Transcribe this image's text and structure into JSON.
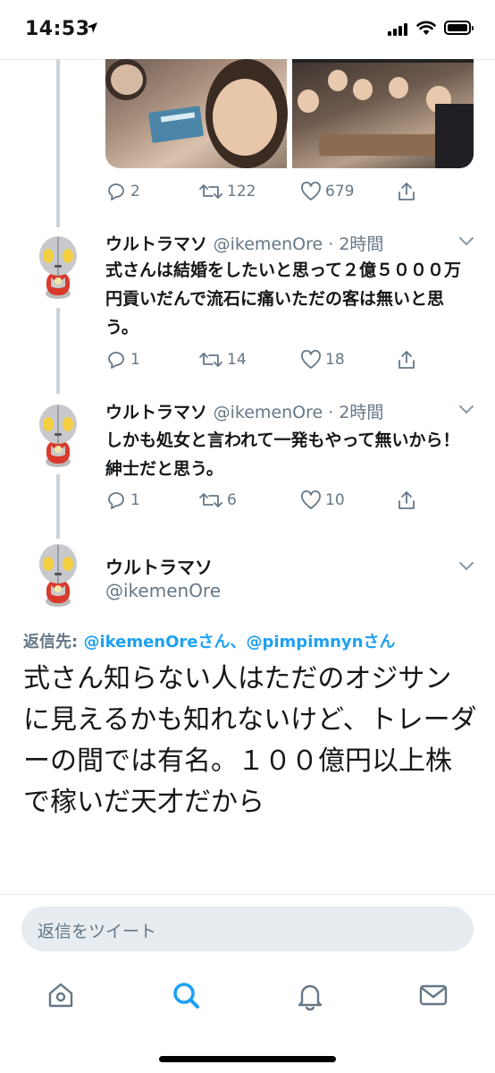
{
  "status_bar": {
    "time": "14:53"
  },
  "photo_tweet": {
    "actions": {
      "replies": "2",
      "retweets": "122",
      "likes": "679"
    }
  },
  "tweets": [
    {
      "display_name": "ウルトラマソ",
      "handle_time": "@ikemenOre · 2時間",
      "text": "式さんは結婚をしたいと思って２億５０００万円貢いだんで流石に痛いただの客は無いと思う。",
      "replies": "1",
      "retweets": "14",
      "likes": "18"
    },
    {
      "display_name": "ウルトラマソ",
      "handle_time": "@ikemenOre · 2時間",
      "text": "しかも処女と言われて一発もやって無いから！紳士だと思う。",
      "replies": "1",
      "retweets": "6",
      "likes": "10"
    }
  ],
  "main_tweet": {
    "display_name": "ウルトラマソ",
    "handle": "@ikemenOre",
    "reply_prefix": "返信先: ",
    "reply_targets": "@ikemenOreさん、@pimpimnynさん",
    "text": "式さん知らない人はただのオジサンに見えるかも知れないけど、トレーダーの間では有名。１００億円以上株で稼いだ天才だから"
  },
  "reply_box": {
    "placeholder": "返信をツイート"
  },
  "tabs": [
    "home-icon",
    "search-icon",
    "notifications-icon",
    "messages-icon"
  ],
  "colors": {
    "accent": "#1da1f2",
    "secondary_text": "#657786",
    "thread_line": "#c9d3da"
  }
}
